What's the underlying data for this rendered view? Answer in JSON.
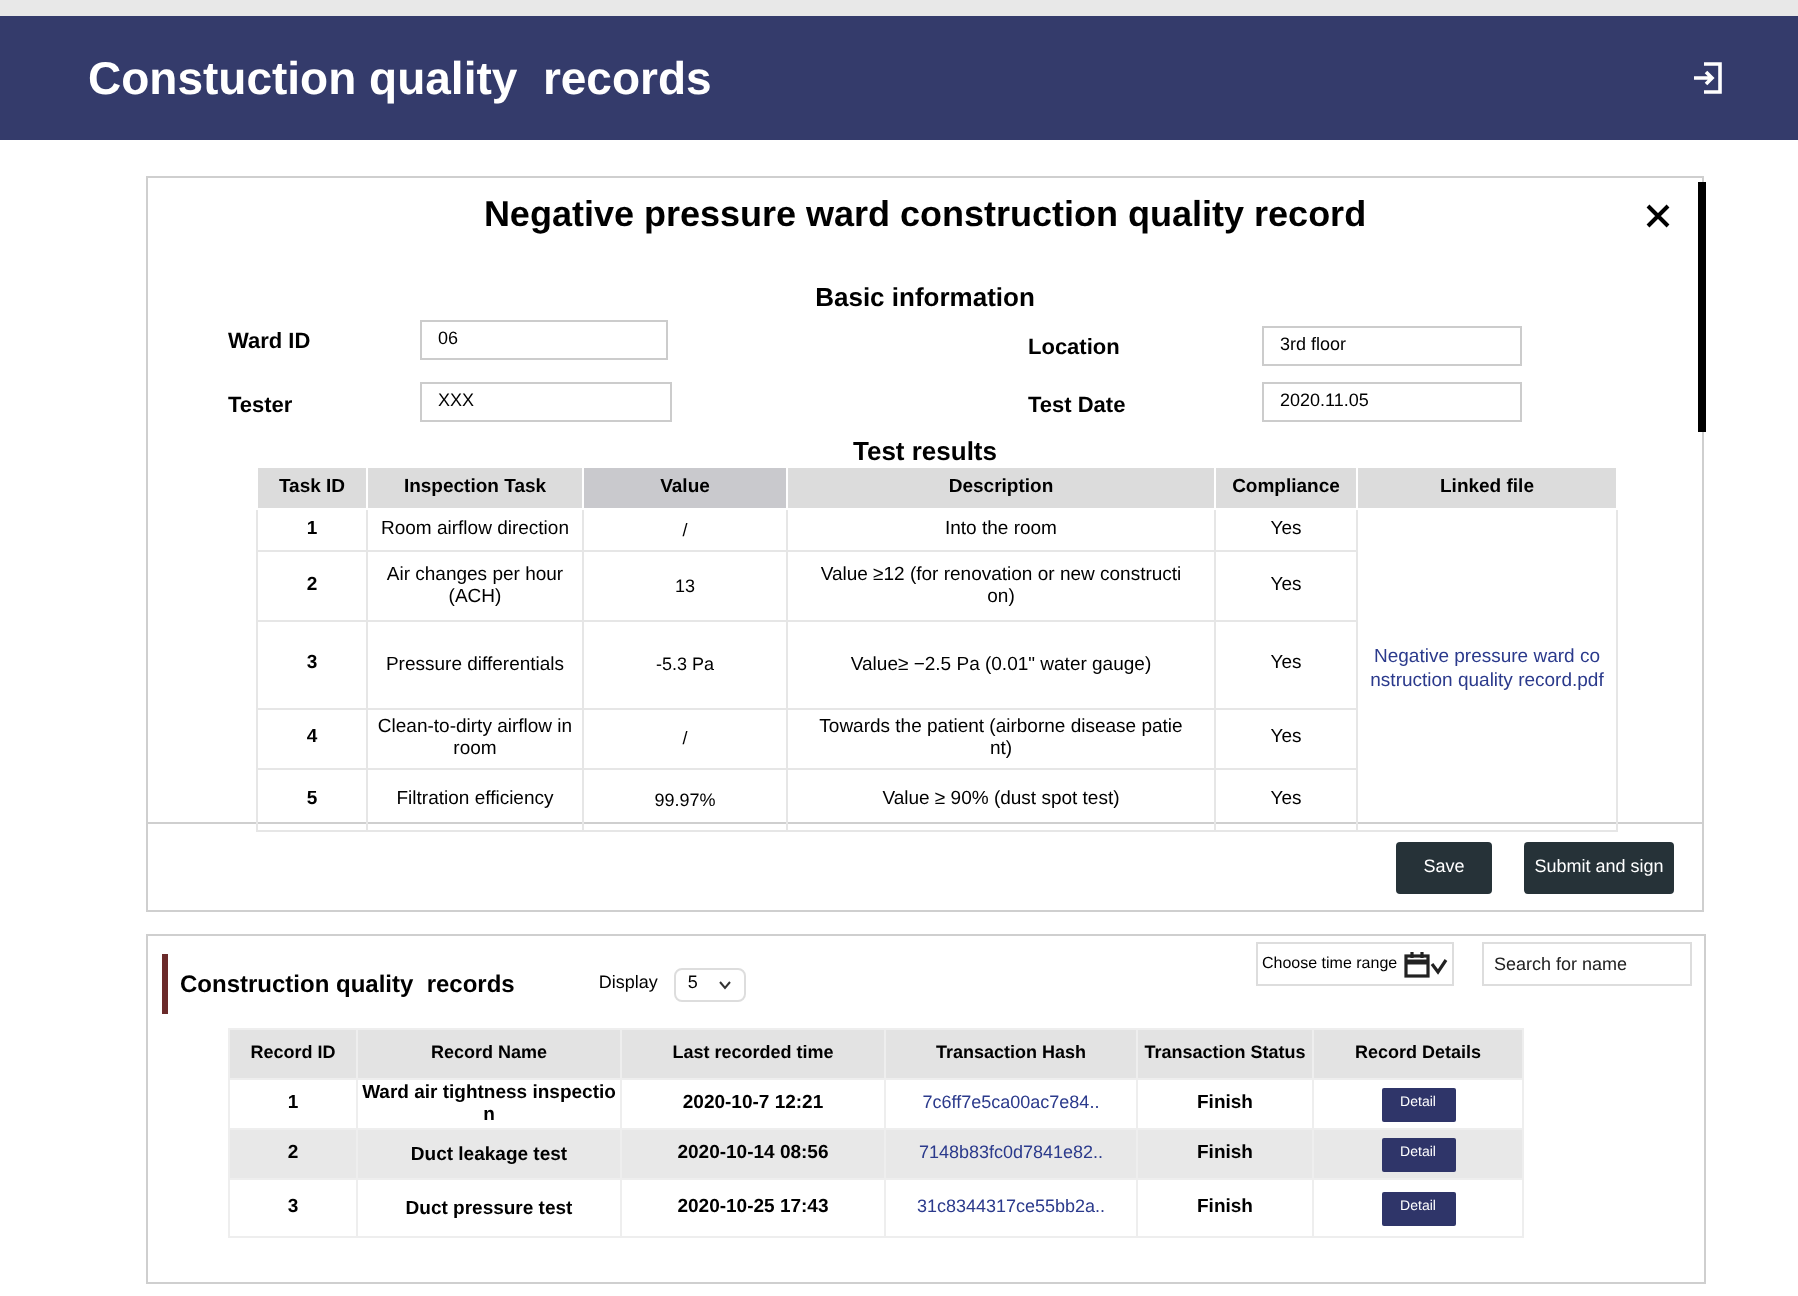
{
  "header": {
    "title": "Constuction quality  records"
  },
  "record_form": {
    "title": "Negative pressure ward construction quality record",
    "section_basic": "Basic information",
    "fields": [
      {
        "label": "Ward ID",
        "value": "06"
      },
      {
        "label": "Location",
        "value": "3rd floor"
      },
      {
        "label": "Tester",
        "value": "XXX"
      },
      {
        "label": "Test Date",
        "value": "2020.11.05"
      }
    ],
    "section_results": "Test results",
    "results_table": {
      "columns": [
        "Task ID",
        "Inspection Task",
        "Value",
        "Description",
        "Compliance",
        "Linked file"
      ],
      "rows": [
        {
          "id": "1",
          "task": "Room airflow direction",
          "value": "/",
          "description": "Into the room",
          "compliance": "Yes"
        },
        {
          "id": "2",
          "task": "Air changes per hour (ACH)",
          "value": "13",
          "description": "Value ≥12 (for renovation or new construction)",
          "compliance": "Yes"
        },
        {
          "id": "3",
          "task": "Pressure differentials",
          "value": "-5.3 Pa",
          "description": "Value≥ −2.5 Pa (0.01\" water gauge)",
          "compliance": "Yes"
        },
        {
          "id": "4",
          "task": "Clean-to-dirty airflow in room",
          "value": "/",
          "description": "Towards the patient (airborne disease patient)",
          "compliance": "Yes"
        },
        {
          "id": "5",
          "task": "Filtration efficiency",
          "value": "99.97%",
          "description": "Value ≥ 90% (dust spot test)",
          "compliance": "Yes"
        }
      ],
      "linked_file": "Negative pressure ward construction quality record.pdf"
    },
    "buttons": [
      "Save",
      "Submit and sign"
    ]
  },
  "records": {
    "title": "Construction quality  records",
    "display_label": "Display",
    "display_value": "5",
    "time_range": "Choose time range",
    "search_placeholder": "Search for name",
    "columns": [
      "Record ID",
      "Record Name",
      "Last recorded time",
      "Transaction Hash",
      "Transaction Status",
      "Record Details"
    ],
    "rows": [
      {
        "id": "1",
        "name": "Ward air tightness inspection",
        "time": "2020-10-7 12:21",
        "hash": "7c6ff7e5ca00ac7e84..",
        "status": "Finish",
        "action": "Detail"
      },
      {
        "id": "2",
        "name": "Duct leakage test",
        "time": "2020-10-14 08:56",
        "hash": "7148b83fc0d7841e82..",
        "status": "Finish",
        "action": "Detail"
      },
      {
        "id": "3",
        "name": "Duct pressure test",
        "time": "2020-10-25 17:43",
        "hash": "31c8344317ce55bb2a..",
        "status": "Finish",
        "action": "Detail"
      }
    ]
  }
}
